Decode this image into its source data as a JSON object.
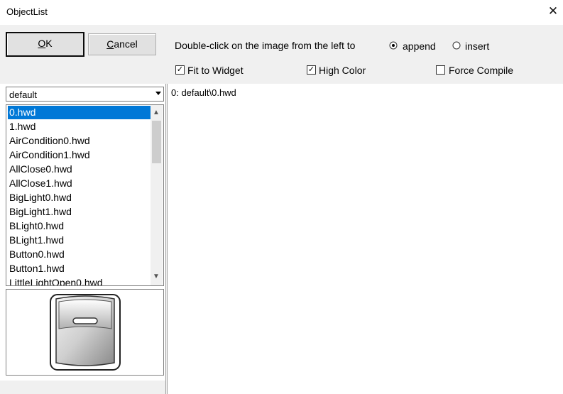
{
  "window": {
    "title": "ObjectList",
    "close_glyph": "✕"
  },
  "toolbar": {
    "ok_label": "OK",
    "ok_mnemonic_rest": "K",
    "cancel_first": "C",
    "cancel_rest": "ancel",
    "instruction": "Double-click on the image from the left to",
    "radio_append": "append",
    "radio_insert": "insert",
    "selected_mode": "append",
    "fit_to_widget": "Fit to Widget",
    "high_color": "High Color",
    "force_compile": "Force Compile",
    "fit_checked": true,
    "high_color_checked": true,
    "force_compile_checked": false
  },
  "combo": {
    "value": "default"
  },
  "list": {
    "items": [
      "0.hwd",
      "1.hwd",
      "AirCondition0.hwd",
      "AirCondition1.hwd",
      "AllClose0.hwd",
      "AllClose1.hwd",
      "BigLight0.hwd",
      "BigLight1.hwd",
      "BLight0.hwd",
      "BLight1.hwd",
      "Button0.hwd",
      "Button1.hwd",
      "LittleLightOpen0.hwd"
    ],
    "selected": "0.hwd"
  },
  "preview": {
    "icon": "rocker-switch-icon"
  },
  "result": {
    "path": "0: default\\0.hwd"
  }
}
